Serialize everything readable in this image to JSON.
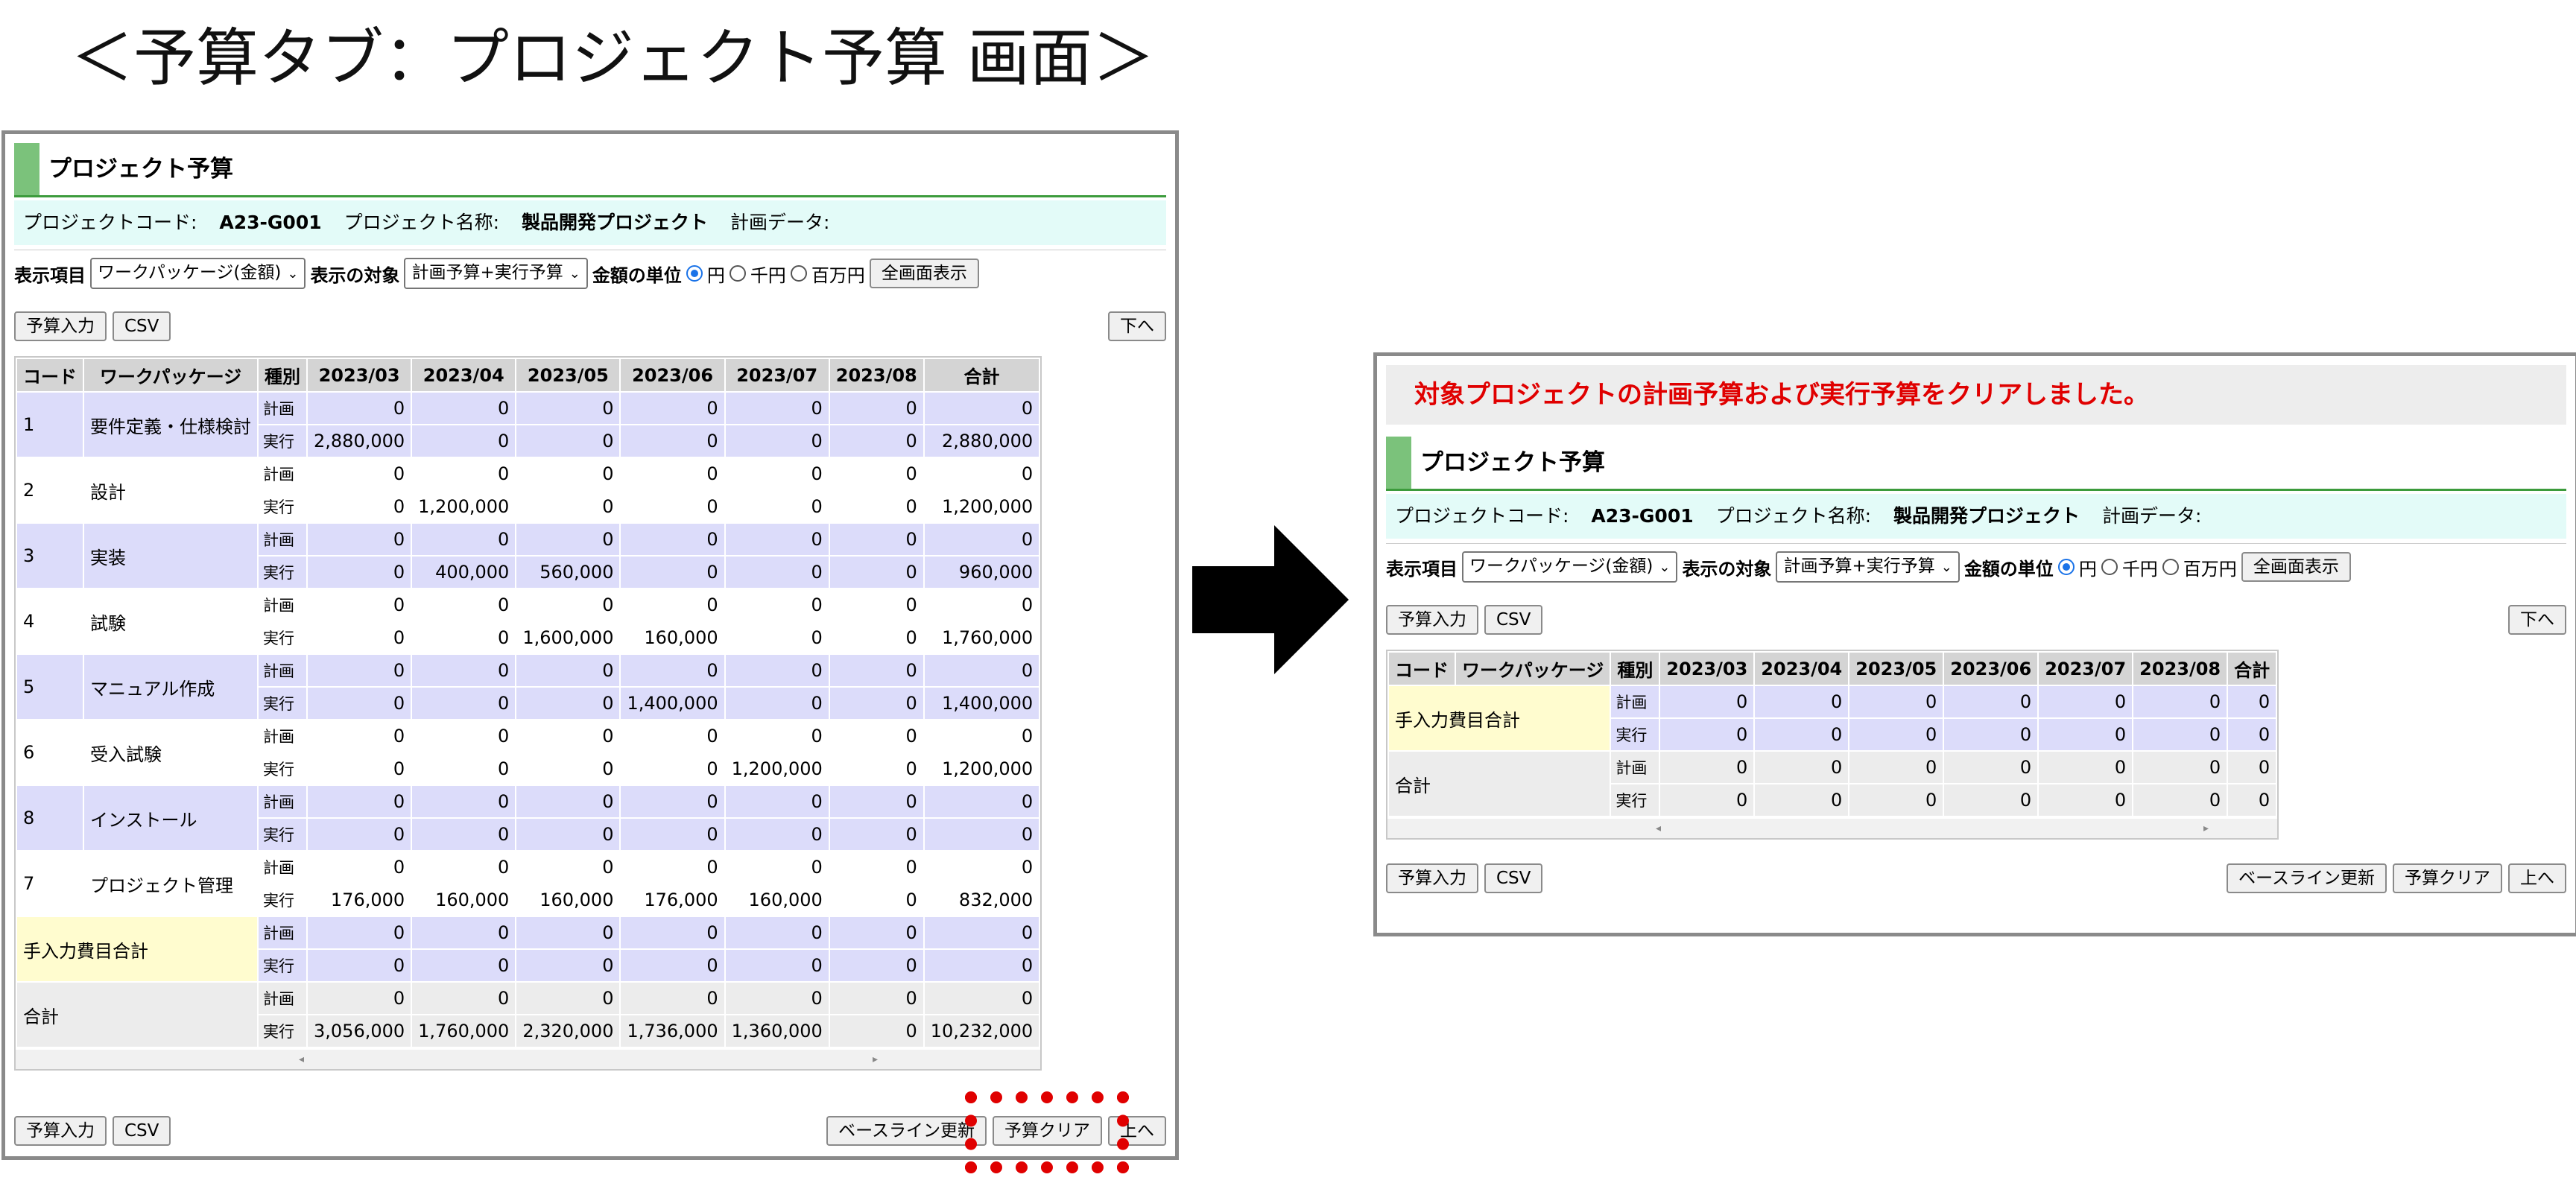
{
  "caption": "＜予算タブ：プロジェクト予算 画面＞",
  "message": "対象プロジェクトの計画予算および実行予算をクリアしました。",
  "title": "プロジェクト予算",
  "info": {
    "code_label": "プロジェクトコード:",
    "code_value": "A23-G001",
    "name_label": "プロジェクト名称:",
    "name_value": "製品開発プロジェクト",
    "plan_label": "計画データ:"
  },
  "filters": {
    "display_item_label": "表示項目",
    "display_item_value": "ワークパッケージ(金額)",
    "target_label": "表示の対象",
    "target_value": "計画予算+実行予算",
    "unit_label": "金額の単位",
    "unit_options": [
      "円",
      "千円",
      "百万円"
    ],
    "unit_selected": "円",
    "fullscreen_button": "全画面表示"
  },
  "buttons": {
    "budget_input": "予算入力",
    "csv": "CSV",
    "down": "下へ",
    "up": "上へ",
    "baseline_update": "ベースライン更新",
    "budget_clear": "予算クリア"
  },
  "table": {
    "headers": [
      "コード",
      "ワークパッケージ",
      "種別",
      "2023/03",
      "2023/04",
      "2023/05",
      "2023/06",
      "2023/07",
      "2023/08",
      "合計"
    ],
    "kind_plan": "計画",
    "kind_exec": "実行",
    "before_rows": [
      {
        "code": "1",
        "name": "要件定義・仕様検討",
        "plan": [
          "0",
          "0",
          "0",
          "0",
          "0",
          "0",
          "0"
        ],
        "exec": [
          "2,880,000",
          "0",
          "0",
          "0",
          "0",
          "0",
          "2,880,000"
        ]
      },
      {
        "code": "2",
        "name": "設計",
        "plan": [
          "0",
          "0",
          "0",
          "0",
          "0",
          "0",
          "0"
        ],
        "exec": [
          "0",
          "1,200,000",
          "0",
          "0",
          "0",
          "0",
          "1,200,000"
        ]
      },
      {
        "code": "3",
        "name": "実装",
        "plan": [
          "0",
          "0",
          "0",
          "0",
          "0",
          "0",
          "0"
        ],
        "exec": [
          "0",
          "400,000",
          "560,000",
          "0",
          "0",
          "0",
          "960,000"
        ]
      },
      {
        "code": "4",
        "name": "試験",
        "plan": [
          "0",
          "0",
          "0",
          "0",
          "0",
          "0",
          "0"
        ],
        "exec": [
          "0",
          "0",
          "1,600,000",
          "160,000",
          "0",
          "0",
          "1,760,000"
        ]
      },
      {
        "code": "5",
        "name": "マニュアル作成",
        "plan": [
          "0",
          "0",
          "0",
          "0",
          "0",
          "0",
          "0"
        ],
        "exec": [
          "0",
          "0",
          "0",
          "1,400,000",
          "0",
          "0",
          "1,400,000"
        ]
      },
      {
        "code": "6",
        "name": "受入試験",
        "plan": [
          "0",
          "0",
          "0",
          "0",
          "0",
          "0",
          "0"
        ],
        "exec": [
          "0",
          "0",
          "0",
          "0",
          "1,200,000",
          "0",
          "1,200,000"
        ]
      },
      {
        "code": "8",
        "name": "インストール",
        "plan": [
          "0",
          "0",
          "0",
          "0",
          "0",
          "0",
          "0"
        ],
        "exec": [
          "0",
          "0",
          "0",
          "0",
          "0",
          "0",
          "0"
        ]
      },
      {
        "code": "7",
        "name": "プロジェクト管理",
        "plan": [
          "0",
          "0",
          "0",
          "0",
          "0",
          "0",
          "0"
        ],
        "exec": [
          "176,000",
          "160,000",
          "160,000",
          "176,000",
          "160,000",
          "0",
          "832,000"
        ]
      }
    ],
    "manual_label": "手入力費目合計",
    "before_manual": {
      "plan": [
        "0",
        "0",
        "0",
        "0",
        "0",
        "0",
        "0"
      ],
      "exec": [
        "0",
        "0",
        "0",
        "0",
        "0",
        "0",
        "0"
      ]
    },
    "total_label": "合計",
    "before_total": {
      "plan": [
        "0",
        "0",
        "0",
        "0",
        "0",
        "0",
        "0"
      ],
      "exec": [
        "3,056,000",
        "1,760,000",
        "2,320,000",
        "1,736,000",
        "1,360,000",
        "0",
        "10,232,000"
      ]
    },
    "after_manual": {
      "plan": [
        "0",
        "0",
        "0",
        "0",
        "0",
        "0",
        "0"
      ],
      "exec": [
        "0",
        "0",
        "0",
        "0",
        "0",
        "0",
        "0"
      ]
    },
    "after_total": {
      "plan": [
        "0",
        "0",
        "0",
        "0",
        "0",
        "0",
        "0"
      ],
      "exec": [
        "0",
        "0",
        "0",
        "0",
        "0",
        "0",
        "0"
      ]
    }
  }
}
